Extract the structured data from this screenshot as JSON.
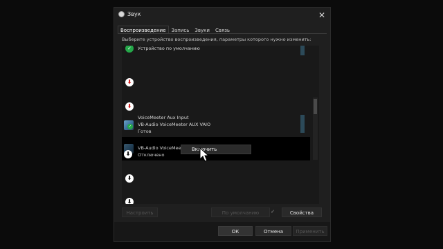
{
  "window": {
    "title": "Звук",
    "close_glyph": "✕"
  },
  "tabs": [
    {
      "label": "Воспроизведение",
      "active": true
    },
    {
      "label": "Запись"
    },
    {
      "label": "Звуки"
    },
    {
      "label": "Связь"
    }
  ],
  "instruction": "Выберите устройство воспроизведения, параметры которого нужно изменить:",
  "devices": [
    {
      "name": "Устройство по умолчанию",
      "status": "",
      "icon": "default-check-icon"
    },
    {
      "name": "",
      "status": "",
      "icon": "disabled-arrow-icon-red"
    },
    {
      "name": "",
      "status": "",
      "icon": "disabled-arrow-icon-red"
    },
    {
      "name1": "VoiceMeeter Aux Input",
      "name2": "VB-Audio VoiceMeeter AUX VAIO",
      "status": "Готов",
      "icon": "speaker-icon"
    },
    {
      "name": "VB-Audio VoiceMeeter VAIO",
      "status": "Отключено",
      "icon": "speaker-disabled-icon",
      "selected": true
    },
    {
      "name": "",
      "status": "",
      "icon": "disabled-arrow-icon"
    },
    {
      "name": "",
      "status": "",
      "icon": "disabled-arrow-icon"
    }
  ],
  "context_menu": {
    "item": "Включить"
  },
  "buttons": {
    "configure": "Настроить",
    "default": "По умолчанию",
    "properties": "Свойства",
    "ok": "ОК",
    "cancel": "Отмена",
    "apply": "Применить"
  },
  "colors": {
    "background": "#1f1f1f",
    "selection": "#000000",
    "accent_green": "#25a84a",
    "disabled_red": "#d11a1a"
  }
}
